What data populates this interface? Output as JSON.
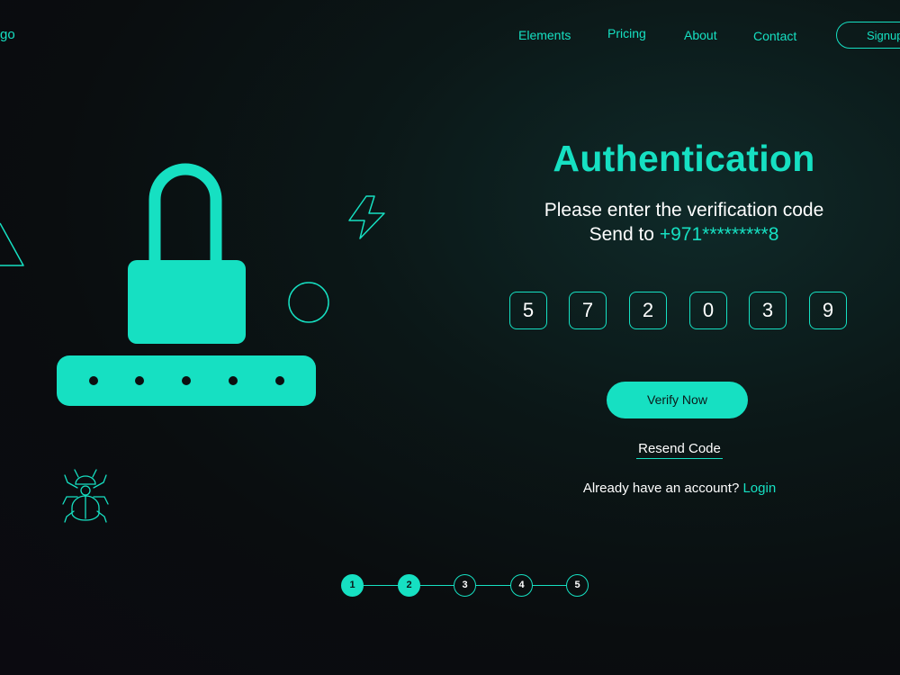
{
  "brand": {
    "logo_text": "go",
    "accent": "#16e0c2",
    "background": "#0b0f10"
  },
  "nav": {
    "links": [
      "Elements",
      "Pricing",
      "About",
      "Contact"
    ],
    "signup_label": "Signup"
  },
  "auth": {
    "title": "Authentication",
    "subtitle": "Please enter the verification code",
    "send_prefix": "Send to",
    "phone": "+971*********8",
    "code_digits": [
      "5",
      "7",
      "2",
      "0",
      "3",
      "9"
    ],
    "verify_label": "Verify Now",
    "resend_label": "Resend Code",
    "account_text": "Already have an account?",
    "login_label": "Login"
  },
  "steps": {
    "items": [
      "1",
      "2",
      "3",
      "4",
      "5"
    ],
    "active_count": 2
  },
  "illustration": {
    "icons": [
      "padlock-icon",
      "password-dots-icon",
      "lightning-icon",
      "circle-shape",
      "triangle-shape",
      "bug-icon"
    ]
  }
}
